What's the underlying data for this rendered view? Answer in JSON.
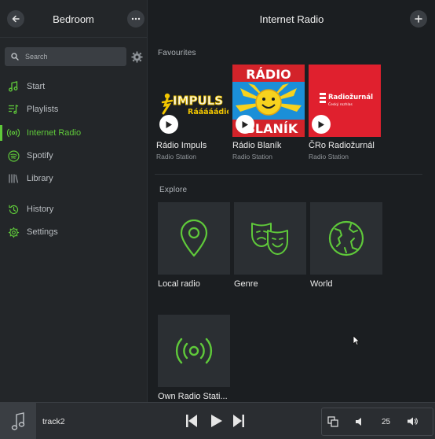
{
  "sidebar": {
    "title": "Bedroom",
    "search_placeholder": "Search",
    "items": [
      {
        "label": "Start",
        "icon": "music-note-icon",
        "active": false
      },
      {
        "label": "Playlists",
        "icon": "playlist-icon",
        "active": false
      },
      {
        "label": "Internet Radio",
        "icon": "radio-waves-icon",
        "active": true
      },
      {
        "label": "Spotify",
        "icon": "spotify-icon",
        "active": false
      },
      {
        "label": "Library",
        "icon": "library-icon",
        "active": false
      },
      {
        "label": "History",
        "icon": "history-icon",
        "active": false
      },
      {
        "label": "Settings",
        "icon": "gear-icon",
        "active": false
      }
    ]
  },
  "main": {
    "title": "Internet Radio",
    "favourites_label": "Favourites",
    "favourites": [
      {
        "name": "Rádio Impuls",
        "type": "Radio Station",
        "logo_text": "IMPULS",
        "logo_sub": "Rááááádio"
      },
      {
        "name": "Rádio Blaník",
        "type": "Radio Station",
        "logo_top": "RÁDIO",
        "logo_bottom": "BLANÍK"
      },
      {
        "name": "ČRo Radiožurnál",
        "type": "Radio Station",
        "logo_text": "Radiožurnál",
        "logo_sub": "Český rozhlas"
      }
    ],
    "explore_label": "Explore",
    "explore": [
      {
        "name": "Local radio",
        "icon": "location-pin-icon"
      },
      {
        "name": "Genre",
        "icon": "theater-masks-icon"
      },
      {
        "name": "World",
        "icon": "globe-icon"
      },
      {
        "name": "Own Radio Stati...",
        "icon": "broadcast-icon"
      }
    ]
  },
  "player": {
    "track": "track2",
    "volume": "25"
  },
  "colors": {
    "accent": "#5fc93a",
    "impuls_yellow": "#f2c600",
    "blanik_red": "#d3232a",
    "blanik_blue": "#1b8fd8",
    "radiozurnal_red": "#e0202e"
  }
}
